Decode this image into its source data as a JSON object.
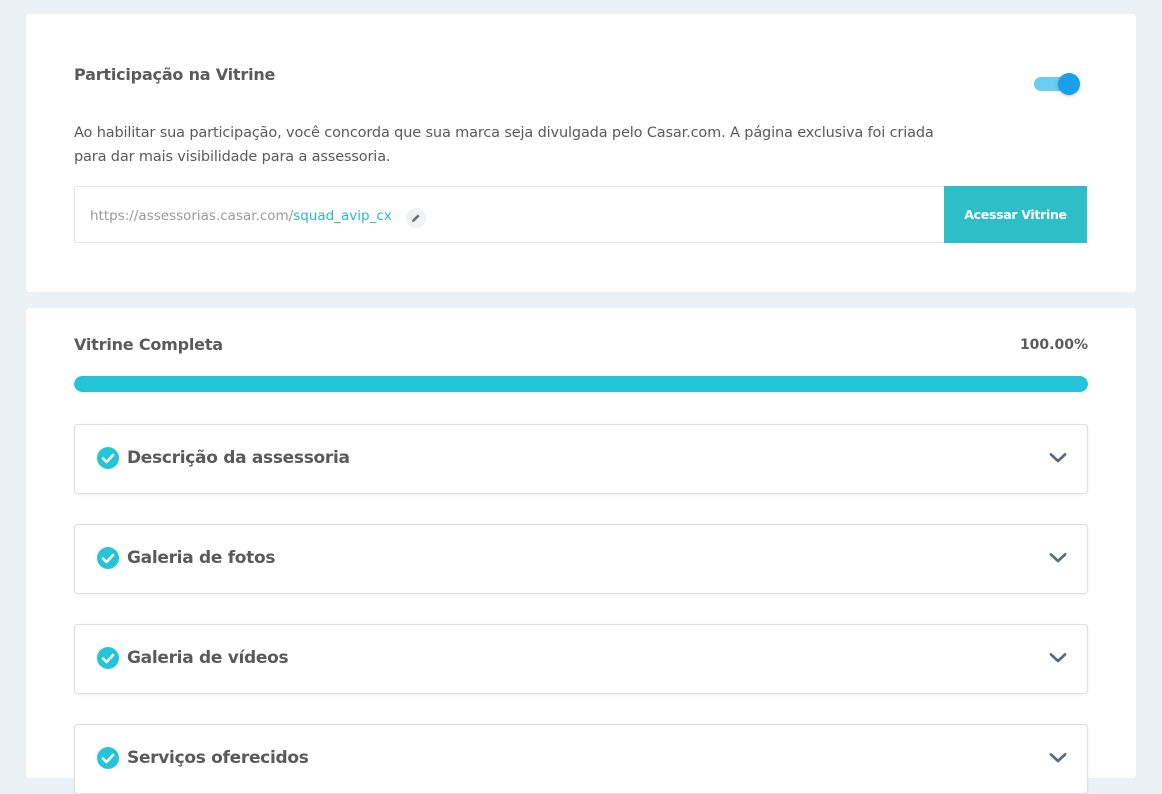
{
  "participation": {
    "title": "Participação na Vitrine",
    "toggle_on": true,
    "description_line1": "Ao habilitar sua participação, você concorda que sua marca seja divulgada pelo Casar.com. A página exclusiva foi criada",
    "description_line2": "para dar mais visibilidade para a assessoria.",
    "url_base": "https://assessorias.casar.com/",
    "url_slug": "squad_avip_cx",
    "edit_icon": "pencil-icon",
    "access_button_label": "Acessar Vitrine"
  },
  "completion": {
    "title": "Vitrine Completa",
    "percent_label": "100.00%",
    "progress_fraction": 1.0,
    "items": [
      {
        "label": "Descrição da assessoria",
        "complete": true
      },
      {
        "label": "Galeria de fotos",
        "complete": true
      },
      {
        "label": "Galeria de vídeos",
        "complete": true
      },
      {
        "label": "Serviços oferecidos",
        "complete": true
      }
    ]
  },
  "colors": {
    "accent": "#2ebec7",
    "progress": "#24c4d9",
    "toggle_knob": "#1a9fe8",
    "toggle_track": "#6ccdf2",
    "check": "#24c4d9"
  }
}
